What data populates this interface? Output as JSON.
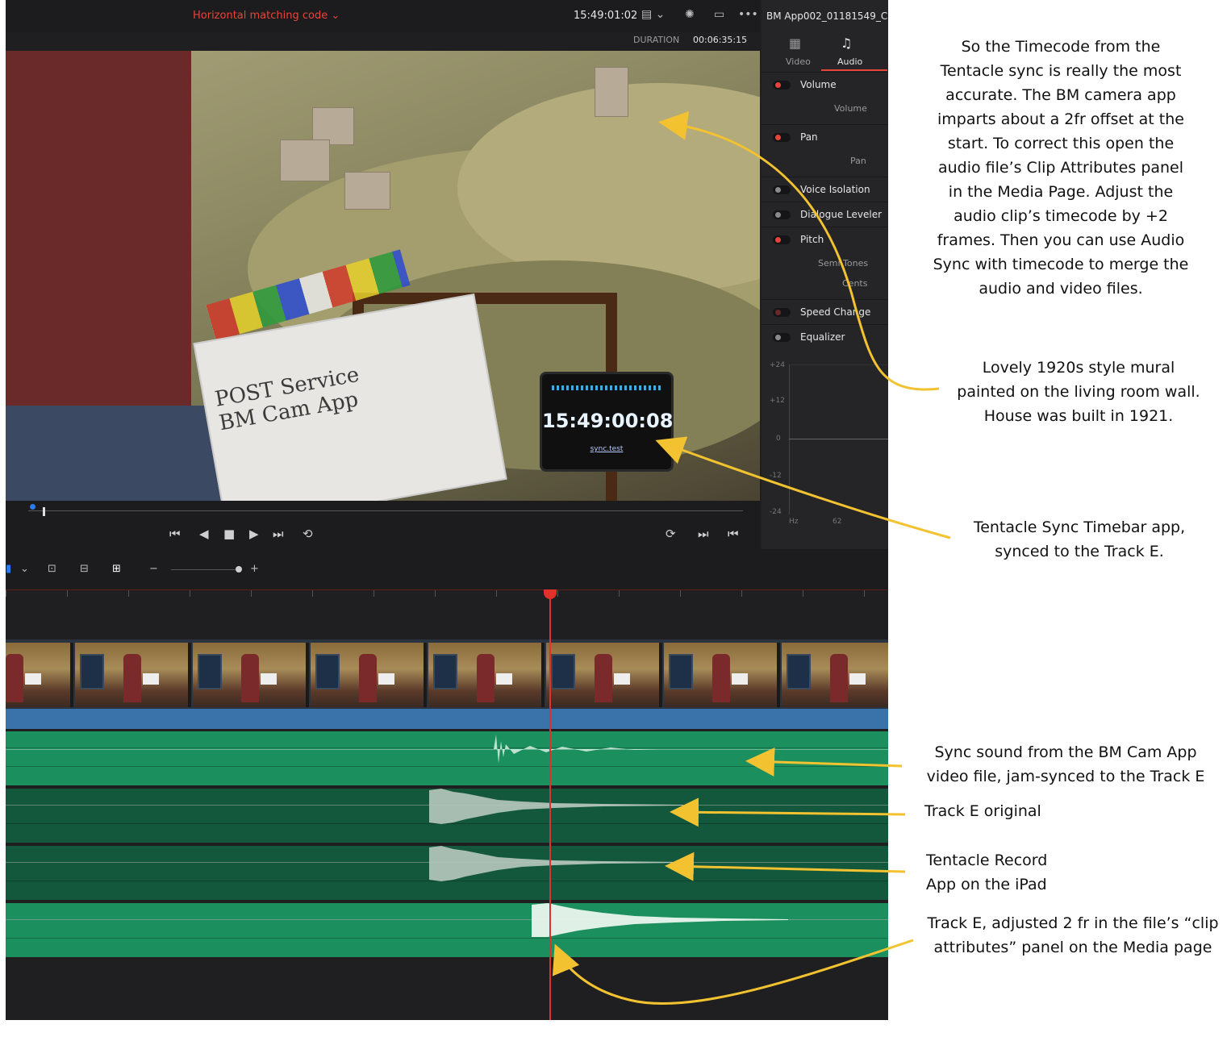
{
  "topbar": {
    "clip_name": "Horizontal matching code",
    "timecode": "15:49:01:02",
    "duration_label": "DURATION",
    "duration_value": "00:06:35:15"
  },
  "viewer": {
    "slate_text": "POST Service\nBM Cam App",
    "ipad_timecode": "15:49:00:08",
    "ipad_link": "sync.test"
  },
  "inspector": {
    "title": "BM App002_01181549_C",
    "tabs": [
      {
        "label": "Video"
      },
      {
        "label": "Audio"
      }
    ],
    "rows": [
      {
        "label": "Volume",
        "sub": "Volume"
      },
      {
        "label": "Pan",
        "sub": "Pan"
      },
      {
        "label": "Voice Isolation"
      },
      {
        "label": "Dialogue Leveler"
      },
      {
        "label": "Pitch",
        "sub": "Semi Tones",
        "sub2": "Cents"
      },
      {
        "label": "Speed Change"
      },
      {
        "label": "Equalizer"
      }
    ],
    "eq_labels": [
      "+24",
      "+12",
      "0",
      "-12",
      "-24"
    ],
    "eq_x_labels": [
      "Hz",
      "62"
    ]
  },
  "colors": {
    "accent_red": "#e8443a",
    "playhead": "#e0312a",
    "audio_green": "#1c8f5e",
    "audio_dark_green": "#13573c",
    "annotation_arrow": "#f2c230"
  },
  "annotations": [
    {
      "text": "So the Timecode from the Tentacle sync is really the most accurate. The BM camera app imparts about a 2fr offset at the start. To correct this open the audio file’s Clip Attributes panel in the Media Page. Adjust the audio clip’s timecode by +2 frames. Then you can use Audio Sync with timecode to merge the audio and video files."
    },
    {
      "text": "Lovely 1920s style mural painted on the living room wall. House was built in 1921."
    },
    {
      "text": "Tentacle Sync Timebar app, synced to the Track E."
    },
    {
      "text": "Sync sound from the BM Cam App video file, jam-synced to the Track E"
    },
    {
      "text": "Track E original"
    },
    {
      "text": "Tentacle Record App on the iPad"
    },
    {
      "text": "Track E, adjusted 2 fr in the file’s “clip attributes” panel on the Media page"
    }
  ]
}
